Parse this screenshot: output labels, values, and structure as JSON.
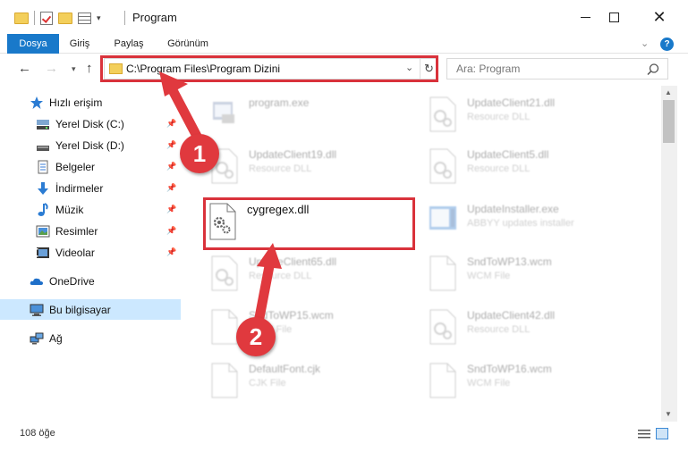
{
  "window": {
    "title": "Program"
  },
  "ribbon": {
    "tabs": [
      "Dosya",
      "Giriş",
      "Paylaş",
      "Görünüm"
    ],
    "help": "?"
  },
  "navigation": {
    "address": "C:\\Program Files\\Program Dizini",
    "search_placeholder": "Ara: Program"
  },
  "sidebar": {
    "items": [
      {
        "label": "Hızlı erişim",
        "icon": "star-icon"
      },
      {
        "label": "Yerel Disk (C:)",
        "icon": "drive-icon",
        "pinned": true
      },
      {
        "label": "Yerel Disk (D:)",
        "icon": "drive-icon",
        "pinned": true
      },
      {
        "label": "Belgeler",
        "icon": "document-icon",
        "pinned": true
      },
      {
        "label": "İndirmeler",
        "icon": "download-icon",
        "pinned": true
      },
      {
        "label": "Müzik",
        "icon": "music-icon",
        "pinned": true
      },
      {
        "label": "Resimler",
        "icon": "picture-icon",
        "pinned": true
      },
      {
        "label": "Videolar",
        "icon": "video-icon",
        "pinned": true
      },
      {
        "label": "OneDrive",
        "icon": "cloud-icon"
      },
      {
        "label": "Bu bilgisayar",
        "icon": "computer-icon",
        "selected": true
      },
      {
        "label": "Ağ",
        "icon": "network-icon"
      }
    ]
  },
  "files": [
    {
      "name": "program.exe",
      "type": ""
    },
    {
      "name": "UpdateClient21.dll",
      "type": "Resource DLL"
    },
    {
      "name": "UpdateClient19.dll",
      "type": "Resource DLL"
    },
    {
      "name": "UpdateClient5.dll",
      "type": "Resource DLL"
    },
    {
      "name": "cygregex.dll",
      "type": ""
    },
    {
      "name": "UpdateInstaller.exe",
      "type": "ABBYY updates installer"
    },
    {
      "name": "UpdateClient65.dll",
      "type": "Resource DLL"
    },
    {
      "name": "SndToWP13.wcm",
      "type": "WCM File"
    },
    {
      "name": "SndToWP15.wcm",
      "type": "WCM File"
    },
    {
      "name": "UpdateClient42.dll",
      "type": "Resource DLL"
    },
    {
      "name": "DefaultFont.cjk",
      "type": "CJK File"
    },
    {
      "name": "SndToWP16.wcm",
      "type": "WCM File"
    }
  ],
  "status": {
    "item_count": "108 öğe"
  },
  "annotations": {
    "step1": "1",
    "step2": "2",
    "color": "#e0393e"
  }
}
